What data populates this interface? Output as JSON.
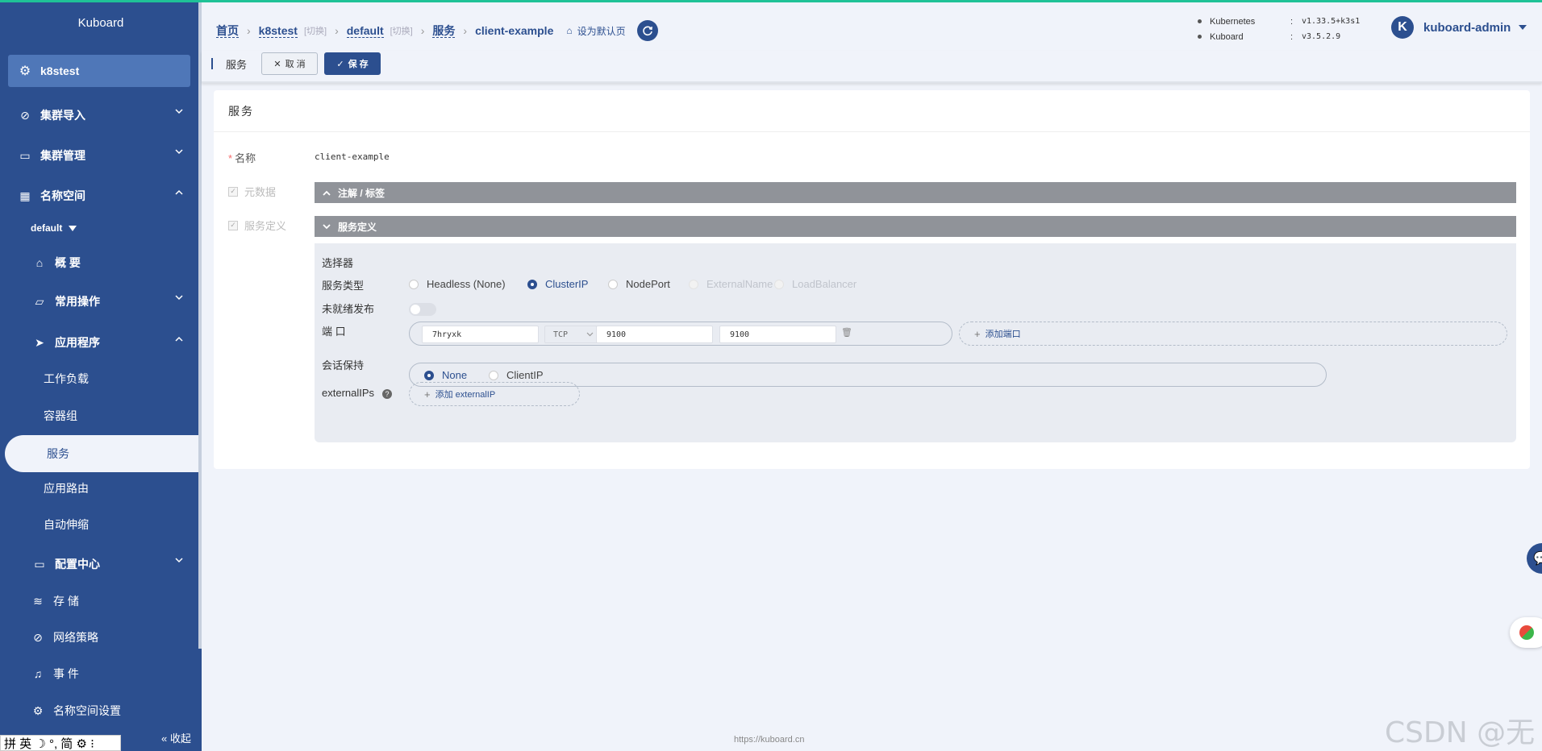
{
  "sidebar": {
    "title": "Kuboard",
    "cluster": "k8stest",
    "items": [
      {
        "label": "集群导入",
        "icon": "link-icon"
      },
      {
        "label": "集群管理",
        "icon": "box-icon"
      },
      {
        "label": "名称空间",
        "icon": "grid-icon"
      },
      {
        "label": "概 要",
        "icon": "home-icon"
      },
      {
        "label": "常用操作",
        "icon": "folder-icon"
      },
      {
        "label": "应用程序",
        "icon": "send-icon"
      },
      {
        "label": "工作负载"
      },
      {
        "label": "容器组"
      },
      {
        "label": "服务"
      },
      {
        "label": "应用路由"
      },
      {
        "label": "自动伸缩"
      },
      {
        "label": "配置中心",
        "icon": "wallet-icon"
      },
      {
        "label": "存 储",
        "icon": "database-icon"
      },
      {
        "label": "网络策略",
        "icon": "link-icon"
      },
      {
        "label": "事 件",
        "icon": "bell-icon"
      },
      {
        "label": "名称空间设置",
        "icon": "gear-icon"
      }
    ],
    "namespace": "default",
    "collapse_label": "收起"
  },
  "ime": {
    "text": "拼 英 ☽ °, 简 ⚙ ⁝"
  },
  "header": {
    "breadcrumb": {
      "home": "首页",
      "cluster": "k8stest",
      "switch": "[切换]",
      "namespace": "default",
      "section": "服务",
      "current": "client-example",
      "set_default": "设为默认页"
    },
    "versions": [
      {
        "name": "Kubernetes",
        "sep": ":",
        "value": "v1.33.5+k3s1"
      },
      {
        "name": "Kuboard",
        "sep": ":",
        "value": "v3.5.2.9"
      }
    ],
    "user": {
      "avatar": "K",
      "name": "kuboard-admin"
    }
  },
  "toolbar": {
    "title": "服务",
    "cancel_label": "取 消",
    "save_label": "保 存"
  },
  "form": {
    "card_title": "服务",
    "name_label": "名称",
    "name_value": "client-example",
    "metadata_label": "元数据",
    "spec_label": "服务定义",
    "annotations_bar": "注解 / 标签",
    "spec_bar": "服务定义",
    "selector_label": "选择器",
    "type_label": "服务类型",
    "types": [
      {
        "label": "Headless (None)",
        "state": "off"
      },
      {
        "label": "ClusterIP",
        "state": "on"
      },
      {
        "label": "NodePort",
        "state": "off"
      },
      {
        "label": "ExternalName",
        "state": "disabled"
      },
      {
        "label": "LoadBalancer",
        "state": "disabled"
      }
    ],
    "unready_label": "未就绪发布",
    "unready_value": false,
    "port_label": "端 口",
    "port": {
      "name": "7hryxk",
      "protocol": "TCP",
      "port": "9100",
      "target_port": "9100"
    },
    "add_port": "添加端口",
    "session_label": "会话保持",
    "session_options": [
      {
        "label": "None",
        "state": "on"
      },
      {
        "label": "ClientIP",
        "state": "off"
      }
    ],
    "external_ips_label": "externalIPs",
    "add_external_ip": "添加 externalIP"
  },
  "footer": {
    "url": "https://kuboard.cn"
  },
  "watermark": "CSDN @无"
}
